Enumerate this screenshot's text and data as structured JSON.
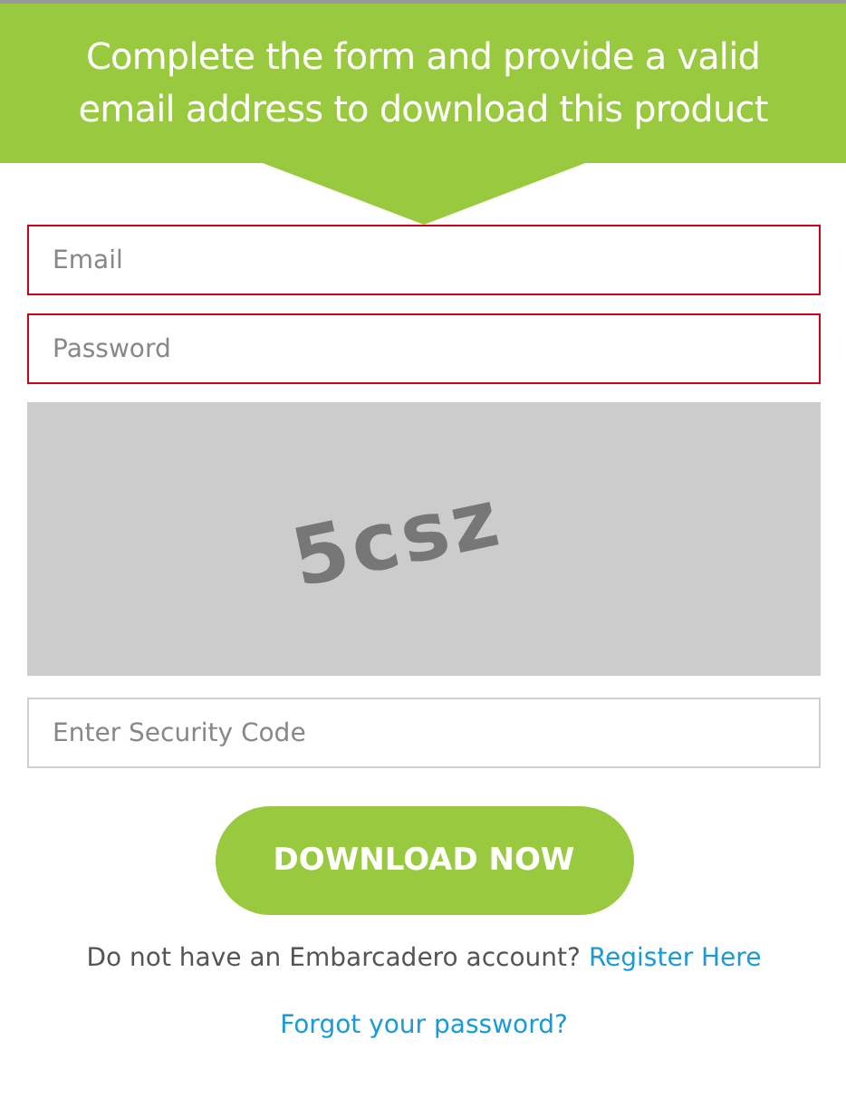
{
  "banner": {
    "text": "Complete the form and provide a valid email address to download this product"
  },
  "fields": [
    {
      "placeholder": "Email",
      "invalid": true
    },
    {
      "placeholder": "Password",
      "invalid": true
    }
  ],
  "captcha": {
    "code": "5csz"
  },
  "security_field": {
    "placeholder": "Enter Security Code",
    "invalid": false
  },
  "download_button": "DOWNLOAD NOW",
  "register": {
    "text": "Do not have an Embarcadero account?",
    "link": "Register Here"
  },
  "forgot_link": "Forgot your password?"
}
